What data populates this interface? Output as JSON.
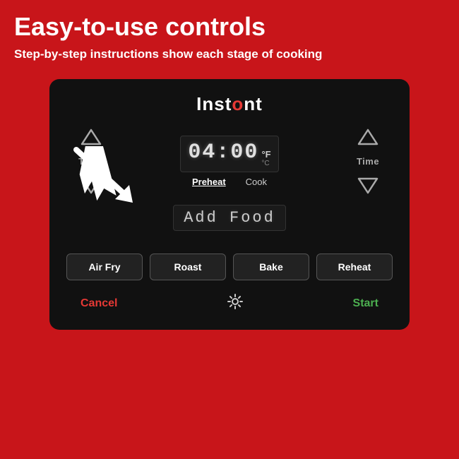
{
  "page": {
    "background_color": "#c8151a"
  },
  "header": {
    "title": "Easy-to-use controls",
    "subtitle": "Step-by-step instructions show each stage of cooking"
  },
  "brand": {
    "name_part1": "Inst",
    "name_dot": "o",
    "name_part2": "nt"
  },
  "display": {
    "time": "04:00",
    "temp_unit": "°F",
    "temp_unit_secondary": "°C",
    "mode_preheat": "Preheat",
    "mode_cook": "Cook",
    "add_food": "Add Food"
  },
  "controls": {
    "temp_label": "Temp",
    "time_label": "Time"
  },
  "buttons": {
    "air_fry": "Air Fry",
    "roast": "Roast",
    "bake": "Bake",
    "reheat": "Reheat"
  },
  "actions": {
    "cancel": "Cancel",
    "start": "Start"
  },
  "icons": {
    "arrow_up": "▲",
    "arrow_down": "▽",
    "light": "✦"
  }
}
